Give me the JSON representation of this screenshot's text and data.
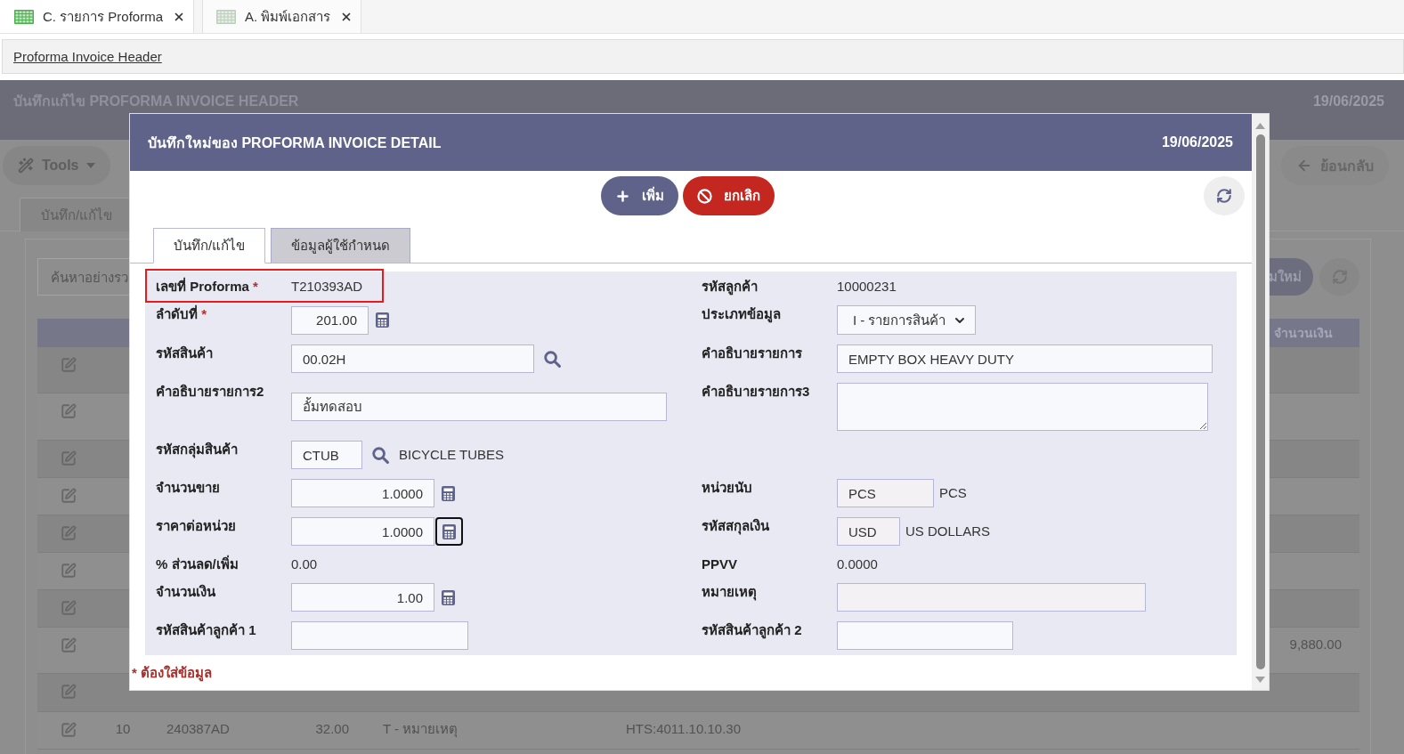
{
  "tabs": [
    {
      "label": "C. รายการ Proforma",
      "selected": true
    },
    {
      "label": "A. พิมพ์เอกสาร",
      "selected": false
    }
  ],
  "breadcrumb": {
    "link": "Proforma Invoice Header"
  },
  "page": {
    "title": "บันทึกแก้ไข PROFORMA INVOICE HEADER",
    "date": "19/06/2025",
    "tools_button": "Tools",
    "back_button": "ย้อนกลับ",
    "tab": "บันทึก/แก้ไข",
    "search": {
      "placeholder": "ค้นหาอย่างรว"
    },
    "add_button": "มใหม่",
    "table": {
      "column_heading": "จำนวนเงิน",
      "rows": [
        {},
        {},
        {},
        {},
        {},
        {},
        {},
        {
          "amount": "9,880.00"
        },
        {},
        {
          "cells": [
            "10",
            "240387AD",
            "32.00",
            "T - หมายเหตุ",
            "HTS:4011.10.10.30"
          ]
        }
      ]
    }
  },
  "modal": {
    "title": "บันทึกใหม่ของ PROFORMA INVOICE DETAIL",
    "date": "19/06/2025",
    "actions": [
      {
        "kind": "add",
        "label": "เพิ่ม"
      },
      {
        "kind": "cancel",
        "label": "ยกเลิก"
      }
    ],
    "tabs": [
      {
        "label": "บันทึก/แก้ไข",
        "selected": true
      },
      {
        "label": "ข้อมูลผู้ใช้กำหนด",
        "selected": false
      }
    ],
    "rows": [
      {
        "left": {
          "label": "เลขที่ Proforma",
          "required_mark": "*",
          "kind": "text",
          "value": "T210393AD",
          "highlighted": true
        },
        "right": {
          "label": "รหัสลูกค้า",
          "kind": "text",
          "value": "10000231",
          "highlighted": false
        }
      },
      {
        "left": {
          "label": "ลำดับที่",
          "required_mark": "*",
          "kind": "number",
          "value": "201.00",
          "readonly": false,
          "highlighted": false,
          "button": {
            "kind": "calculator",
            "focused": false
          }
        },
        "right": {
          "label": "ประเภทข้อมูล",
          "kind": "select",
          "value": "I - รายการสินค้า",
          "highlighted": false
        }
      },
      {
        "left": {
          "label": "รหัสสินค้า",
          "kind": "input",
          "value": "00.02H",
          "readonly": false,
          "highlighted": false,
          "button": {
            "kind": "search",
            "focused": false
          }
        },
        "right": {
          "label": "คำอธิบายรายการ",
          "kind": "input",
          "value": "EMPTY BOX HEAVY DUTY",
          "readonly": false,
          "highlighted": false
        }
      },
      {
        "left": {
          "label": "คำอธิบายรายการ2",
          "kind": "input",
          "value": "อั้มทดสอบ",
          "readonly": false,
          "highlighted": false
        },
        "right": {
          "label": "คำอธิบายรายการ3",
          "kind": "textarea",
          "readonly": false,
          "highlighted": false
        }
      },
      {
        "left": {
          "label": "รหัสกลุ่มสินค้า",
          "kind": "input",
          "value": "CTUB",
          "readonly": false,
          "highlighted": false,
          "button": {
            "kind": "search",
            "focused": false
          },
          "suffix": "BICYCLE TUBES"
        }
      },
      {
        "left": {
          "label": "จำนวนขาย",
          "kind": "number",
          "value": "1.0000",
          "readonly": false,
          "highlighted": false,
          "button": {
            "kind": "calculator",
            "focused": false
          }
        },
        "right": {
          "label": "หน่วยนับ",
          "kind": "input",
          "value": "PCS",
          "readonly": true,
          "highlighted": false,
          "suffix": "PCS"
        }
      },
      {
        "left": {
          "label": "ราคาต่อหน่วย",
          "kind": "number",
          "value": "1.0000",
          "readonly": false,
          "highlighted": false,
          "button": {
            "kind": "calculator",
            "focused": true
          }
        },
        "right": {
          "label": "รหัสสกุลเงิน",
          "kind": "input",
          "value": "USD",
          "readonly": true,
          "highlighted": false,
          "suffix": "US DOLLARS"
        }
      },
      {
        "left": {
          "label": "% ส่วนลด/เพิ่ม",
          "kind": "text",
          "value": "0.00",
          "highlighted": false
        },
        "right": {
          "label": "PPVV",
          "kind": "text",
          "value": "0.0000",
          "highlighted": false
        }
      },
      {
        "left": {
          "label": "จำนวนเงิน",
          "kind": "number",
          "value": "1.00",
          "readonly": false,
          "highlighted": false,
          "button": {
            "kind": "calculator",
            "focused": false
          }
        },
        "right": {
          "label": "หมายเหตุ",
          "kind": "input",
          "readonly": true,
          "highlighted": false
        }
      },
      {
        "left": {
          "label": "รหัสสินค้าลูกค้า 1",
          "kind": "input",
          "readonly": false,
          "highlighted": false
        },
        "right": {
          "label": "รหัสสินค้าลูกค้า 2",
          "kind": "input",
          "readonly": false,
          "highlighted": false
        }
      }
    ],
    "note": "* ต้องใส่ข้อมูล"
  }
}
